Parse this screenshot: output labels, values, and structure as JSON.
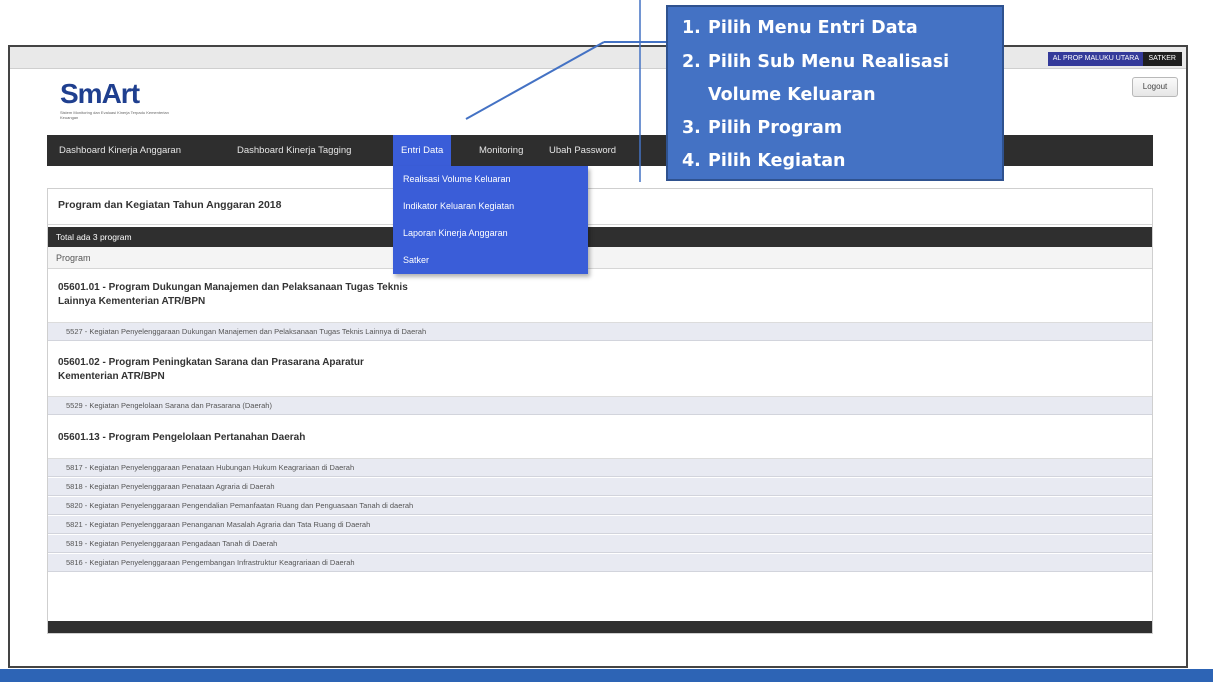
{
  "header": {
    "user_label": "AL PROP MALUKU UTARA",
    "satker_label": "SATKER",
    "logout_label": "Logout"
  },
  "logo": {
    "text": "SmArt",
    "subtitle": "Sistem Monitoring dan Evaluasi Kinerja Terpadu Kementerian Keuangan"
  },
  "nav": {
    "items": [
      {
        "label": "Dashboard Kinerja Anggaran"
      },
      {
        "label": "Dashboard Kinerja Tagging"
      },
      {
        "label": "Entri Data"
      },
      {
        "label": "Monitoring"
      },
      {
        "label": "Ubah Password"
      }
    ]
  },
  "dropdown": {
    "items": [
      {
        "label": "Realisasi Volume Keluaran"
      },
      {
        "label": "Indikator Keluaran Kegiatan"
      },
      {
        "label": "Laporan Kinerja Anggaran"
      },
      {
        "label": "Satker"
      }
    ]
  },
  "panel": {
    "title": "Program dan Kegiatan Tahun Anggaran 2018",
    "count_text": "Total ada 3 program",
    "column_header": "Program",
    "programs": [
      {
        "title_line1": "05601.01 - Program Dukungan Manajemen dan Pelaksanaan Tugas Teknis",
        "title_line2": "Lainnya Kementerian ATR/BPN",
        "activities": [
          "5527 - Kegiatan Penyelenggaraan Dukungan Manajemen dan Pelaksanaan Tugas Teknis Lainnya di Daerah"
        ]
      },
      {
        "title_line1": "05601.02 - Program Peningkatan Sarana dan Prasarana Aparatur",
        "title_line2": "Kementerian ATR/BPN",
        "activities": [
          "5529 - Kegiatan Pengelolaan Sarana dan Prasarana (Daerah)"
        ]
      },
      {
        "title_line1": "05601.13 - Program Pengelolaan Pertanahan Daerah",
        "title_line2": "",
        "activities": [
          "5817 - Kegiatan Penyelenggaraan Penataan Hubungan Hukum Keagrariaan di Daerah",
          "5818 - Kegiatan Penyelenggaraan Penataan Agraria di Daerah",
          "5820 - Kegiatan Penyelenggaraan Pengendalian Pemanfaatan Ruang dan Penguasaan Tanah di daerah",
          "5821 - Kegiatan Penyelenggaraan Penanganan Masalah Agraria dan Tata Ruang di Daerah",
          "5819 - Kegiatan Penyelenggaraan Pengadaan Tanah di Daerah",
          "5816 - Kegiatan Penyelenggaraan Pengembangan Infrastruktur Keagrariaan di Daerah"
        ]
      }
    ]
  },
  "callout": {
    "steps": [
      {
        "num": "1.",
        "text": "Pilih Menu Entri Data"
      },
      {
        "num": "2.",
        "text": "Pilih Sub Menu Realisasi"
      },
      {
        "num": "",
        "text": "Volume Keluaran"
      },
      {
        "num": "3.",
        "text": "Pilih Program"
      },
      {
        "num": "4.",
        "text": "Pilih Kegiatan"
      }
    ]
  }
}
